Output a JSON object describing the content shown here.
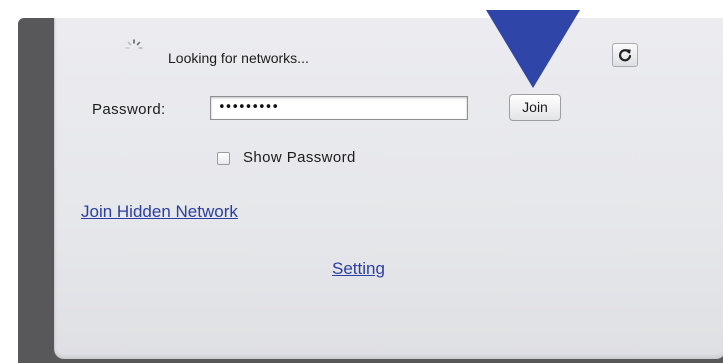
{
  "status": {
    "message": "Looking for networks..."
  },
  "password": {
    "label": "Password:",
    "value": "•••••••••"
  },
  "join_button": {
    "label": "Join"
  },
  "show_password": {
    "label": "Show Password",
    "checked": false
  },
  "links": {
    "join_hidden_network": "Join Hidden Network",
    "setting": "Setting"
  },
  "icons": {
    "spinner": "loading-spinner-icon",
    "refresh": "refresh-icon",
    "pointer": "pointer-arrow-icon"
  },
  "colors": {
    "link": "#2c3ea3",
    "pointer": "#2f45a8",
    "frame": "#58585b"
  }
}
